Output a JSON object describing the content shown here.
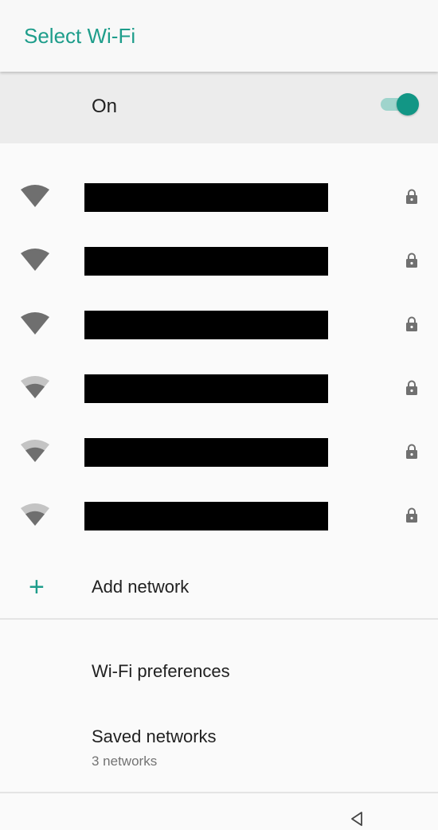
{
  "app_bar": {
    "title": "Select Wi-Fi"
  },
  "master_switch": {
    "label": "On",
    "enabled": true,
    "accent_color": "#129685"
  },
  "networks": [
    {
      "ssid": "",
      "redacted": true,
      "signal_icon": "wifi-signal-full-icon",
      "secured": true
    },
    {
      "ssid": "",
      "redacted": true,
      "signal_icon": "wifi-signal-full-icon",
      "secured": true
    },
    {
      "ssid": "",
      "redacted": true,
      "signal_icon": "wifi-signal-full-icon",
      "secured": true
    },
    {
      "ssid": "",
      "redacted": true,
      "signal_icon": "wifi-signal-medium-icon",
      "secured": true
    },
    {
      "ssid": "",
      "redacted": true,
      "signal_icon": "wifi-signal-medium-icon",
      "secured": true
    },
    {
      "ssid": "",
      "redacted": true,
      "signal_icon": "wifi-signal-medium-icon",
      "secured": true
    }
  ],
  "add_network": {
    "icon": "plus-icon",
    "label": "Add network"
  },
  "preferences": {
    "wifi_preferences_label": "Wi-Fi preferences",
    "saved_networks_label": "Saved networks",
    "saved_networks_sub": "3 networks"
  },
  "nav_bar": {
    "back_icon": "back-triangle-icon"
  }
}
